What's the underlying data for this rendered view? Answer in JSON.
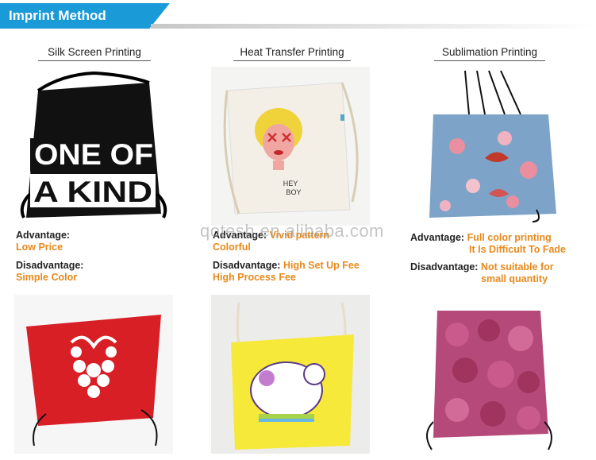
{
  "header": {
    "title": "Imprint Method"
  },
  "columns": [
    {
      "heading": "Silk Screen Printing",
      "advantage_label": "Advantage:",
      "advantage_value": "Low Price",
      "disadvantage_label": "Disadvantage:",
      "disadvantage_value": "Simple Color",
      "bag_print": [
        "ONE OF",
        "A KIND"
      ]
    },
    {
      "heading": "Heat Transfer Printing",
      "advantage_label": "Advantage:",
      "advantage_value": "Vivid pattern",
      "advantage_value_2": "Colorful",
      "disadvantage_label": "Disadvantage:",
      "disadvantage_value": "High Set Up Fee",
      "disadvantage_value_2": "High Process Fee",
      "bag_print": [
        "HEY",
        "BOY"
      ]
    },
    {
      "heading": "Sublimation Printing",
      "advantage_label": "Advantage:",
      "advantage_value": "Full color printing",
      "advantage_value_2": "It Is Difficult To Fade",
      "disadvantage_label": "Disadvantage:",
      "disadvantage_value": "Not suitable for",
      "disadvantage_value_2": "small quantity"
    }
  ],
  "watermark": "qotesh.en.alibaba.com",
  "colors": {
    "banner": "#1a9ad6",
    "accent": "#e8891c"
  }
}
